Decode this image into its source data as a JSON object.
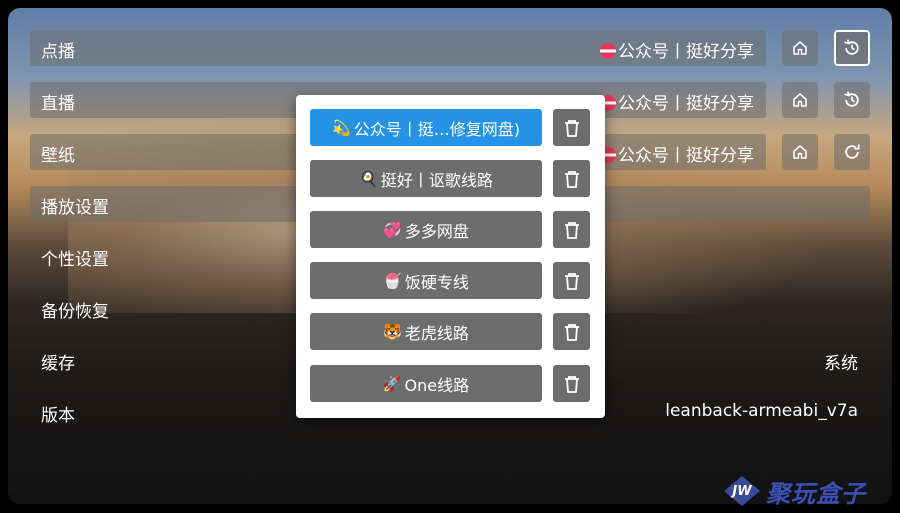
{
  "settings": {
    "items": [
      {
        "label": "点播",
        "value": "公众号丨挺好分享"
      },
      {
        "label": "直播",
        "value": "公众号丨挺好分享"
      },
      {
        "label": "壁纸",
        "value": "公众号丨挺好分享"
      },
      {
        "label": "播放设置"
      },
      {
        "label": "个性设置"
      },
      {
        "label": "备份恢复"
      },
      {
        "label": "缓存",
        "value": "系统"
      },
      {
        "label": "版本",
        "value": "leanback-armeabi_v7a"
      }
    ],
    "icons": {
      "home": "home-icon",
      "history": "history-icon",
      "refresh": "refresh-icon"
    }
  },
  "dialog": {
    "sites": [
      {
        "emoji": "💫",
        "label": "公众号丨挺…修复网盘)",
        "selected": true
      },
      {
        "emoji": "🍳",
        "label": "挺好丨讴歌线路",
        "selected": false
      },
      {
        "emoji": "💞",
        "label": "多多网盘",
        "selected": false
      },
      {
        "emoji": "🍧",
        "label": "饭硬专线",
        "selected": false
      },
      {
        "emoji": "🐯",
        "label": "老虎线路",
        "selected": false
      },
      {
        "emoji": "🚀",
        "label": "One线路",
        "selected": false
      }
    ]
  },
  "watermark": {
    "logo": "JW",
    "text": "聚玩盒子"
  },
  "colors": {
    "accent": "#2493e6",
    "button": "#6d6d6d",
    "watermark": "#3b4fb6"
  }
}
